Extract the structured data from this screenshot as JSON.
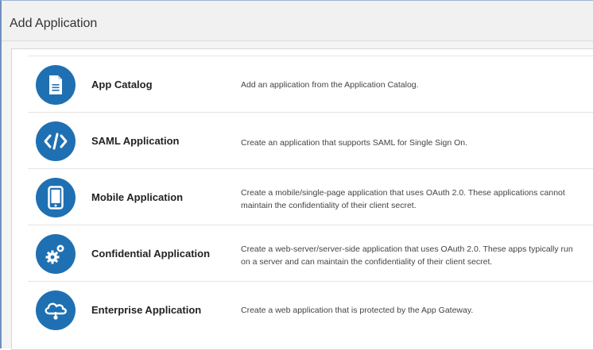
{
  "header": {
    "title": "Add Application"
  },
  "accent_color": "#1f70b2",
  "applications": [
    {
      "title": "App Catalog",
      "description": "Add an application from the Application Catalog.",
      "icon": "document-icon"
    },
    {
      "title": "SAML Application",
      "description": "Create an application that supports SAML for Single Sign On.",
      "icon": "code-icon"
    },
    {
      "title": "Mobile Application",
      "description": "Create a mobile/single-page application that uses OAuth 2.0. These applications cannot maintain the confidentiality of their client secret.",
      "icon": "mobile-device-icon"
    },
    {
      "title": "Confidential Application",
      "description": "Create a web-server/server-side application that uses OAuth 2.0. These apps typically run on a server and can maintain the confidentiality of their client secret.",
      "icon": "gears-icon"
    },
    {
      "title": "Enterprise Application",
      "description": "Create a web application that is protected by the App Gateway.",
      "icon": "cloud-gateway-icon"
    }
  ]
}
